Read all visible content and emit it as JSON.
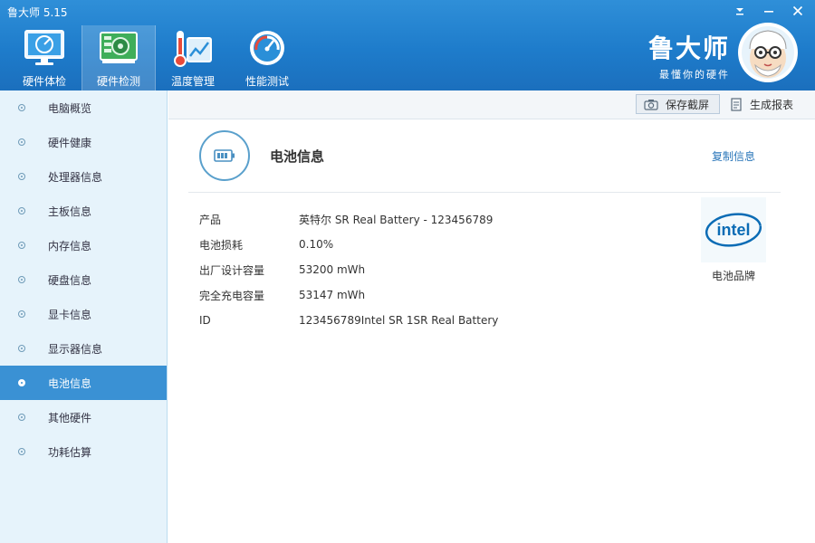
{
  "app": {
    "title": "鲁大师 5.15"
  },
  "nav": {
    "items": [
      {
        "label": "硬件体检",
        "icon": "monitor-check-icon"
      },
      {
        "label": "硬件检测",
        "icon": "circuit-board-icon"
      },
      {
        "label": "温度管理",
        "icon": "thermometer-icon"
      },
      {
        "label": "性能测试",
        "icon": "speedometer-icon"
      }
    ],
    "active_index": 1
  },
  "brand": {
    "name": "鲁大师",
    "slogan": "最懂你的硬件"
  },
  "sidebar": {
    "items": [
      {
        "label": "电脑概览"
      },
      {
        "label": "硬件健康"
      },
      {
        "label": "处理器信息"
      },
      {
        "label": "主板信息"
      },
      {
        "label": "内存信息"
      },
      {
        "label": "硬盘信息"
      },
      {
        "label": "显卡信息"
      },
      {
        "label": "显示器信息"
      },
      {
        "label": "电池信息"
      },
      {
        "label": "其他硬件"
      },
      {
        "label": "功耗估算"
      }
    ],
    "active_index": 8
  },
  "toolbar": {
    "save_screenshot": "保存截屏",
    "generate_report": "生成报表"
  },
  "section": {
    "title": "电池信息",
    "copy_link": "复制信息",
    "icon": "battery-icon"
  },
  "info": {
    "rows": [
      {
        "key": "产品",
        "value": "英特尔 SR Real Battery - 123456789"
      },
      {
        "key": "电池损耗",
        "value": "0.10%"
      },
      {
        "key": "出厂设计容量",
        "value": "53200 mWh"
      },
      {
        "key": "完全充电容量",
        "value": "53147 mWh"
      },
      {
        "key": "ID",
        "value": "123456789Intel SR 1SR Real Battery"
      }
    ]
  },
  "brand_logo": {
    "text": "intel",
    "caption": "电池品牌",
    "color": "#0b6cb5"
  },
  "colors": {
    "header": "#1e7ccb",
    "sidebar_bg": "#e6f3fb",
    "active": "#3a91d4",
    "link": "#2a76b9"
  }
}
